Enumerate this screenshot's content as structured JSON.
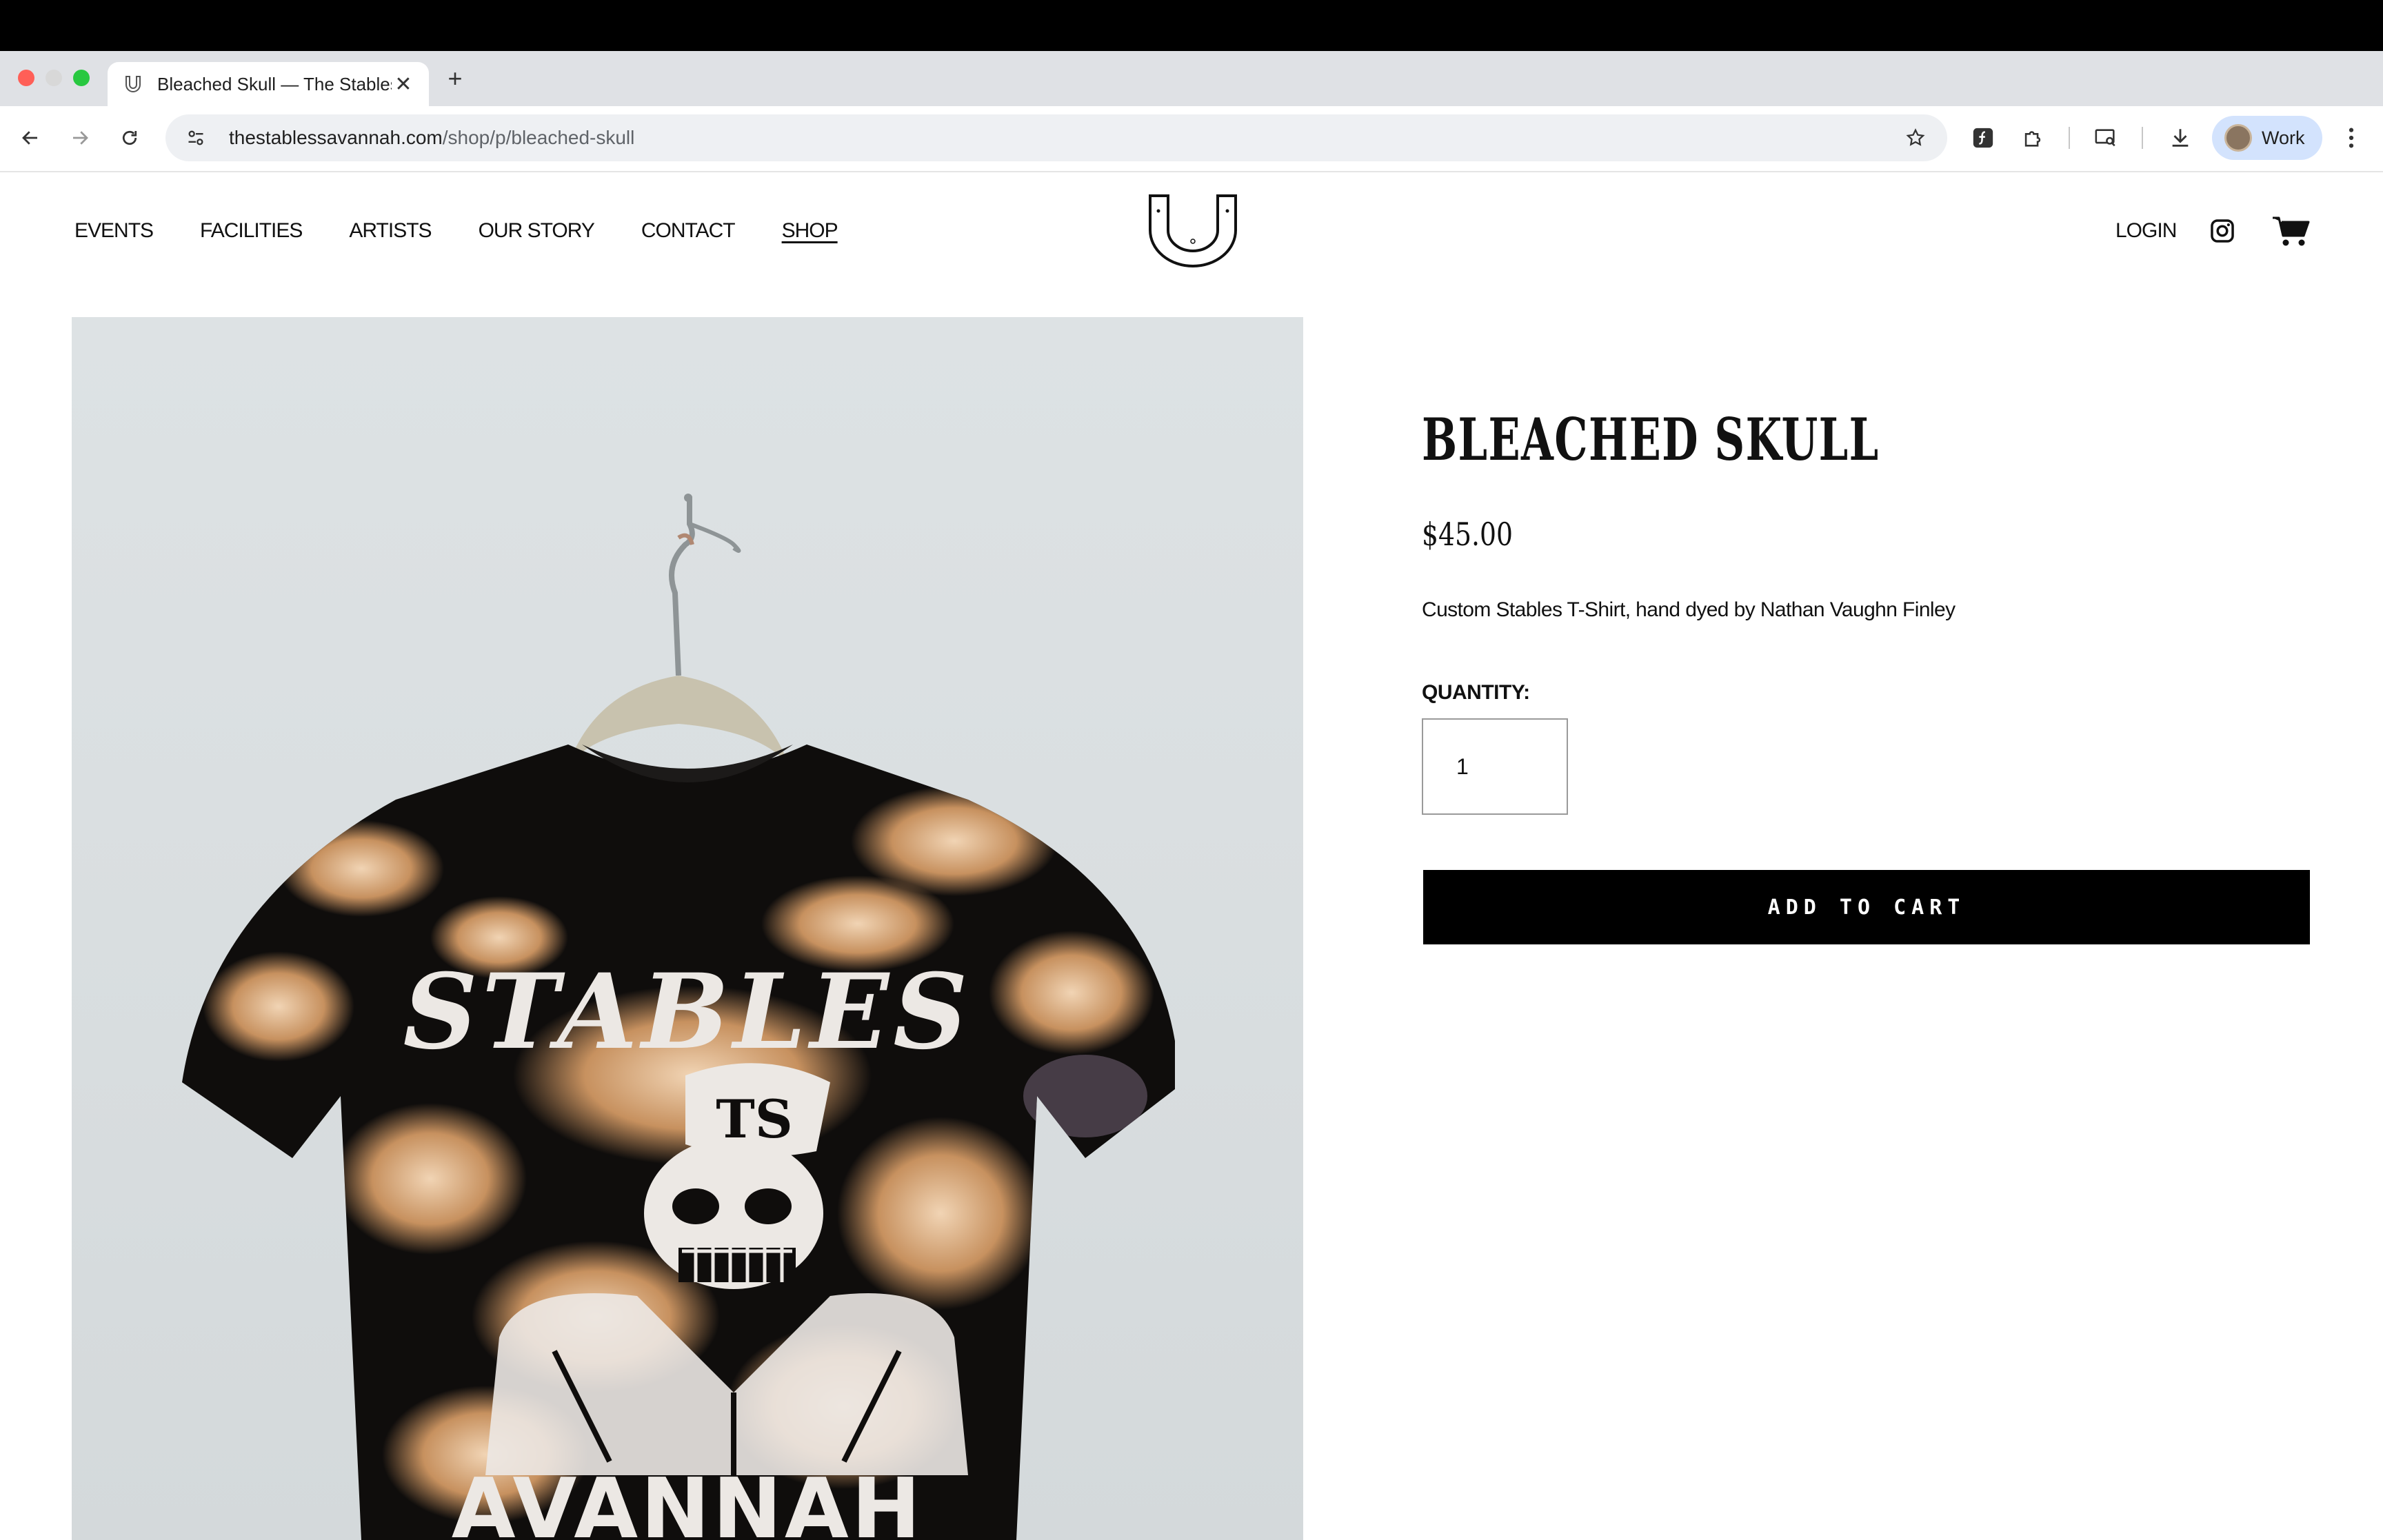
{
  "browser": {
    "tab": {
      "title": "Bleached Skull — The Stables",
      "close_icon": "close-icon"
    },
    "new_tab_label": "+",
    "url": {
      "domain": "thestablessavannah.com",
      "path": "/shop/p/bleached-skull"
    },
    "profile": {
      "label": "Work"
    },
    "icons": [
      "back-icon",
      "forward-icon",
      "reload-icon",
      "tune-icon",
      "star-icon",
      "extension-script-icon",
      "puzzle-icon",
      "cast-search-icon",
      "download-icon",
      "kebab-icon"
    ],
    "colors": {
      "chrome_bg": "#dfe1e5",
      "omnibox_bg": "#eef0f3",
      "profile_chip": "#d3e3fd"
    }
  },
  "site": {
    "nav": [
      {
        "label": "EVENTS"
      },
      {
        "label": "FACILITIES"
      },
      {
        "label": "ARTISTS"
      },
      {
        "label": "OUR STORY"
      },
      {
        "label": "CONTACT"
      },
      {
        "label": "SHOP",
        "active": true
      }
    ],
    "login_label": "LOGIN",
    "logo_icon": "stables-horseshoe-logo",
    "instagram_icon": "instagram-icon",
    "cart_icon": "cart-icon"
  },
  "product": {
    "title": "BLEACHED SKULL",
    "price": "$45.00",
    "description": "Custom Stables T-Shirt, hand dyed by Nathan Vaughn Finley",
    "quantity_label": "QUANTITY:",
    "quantity_value": "1",
    "add_to_cart_label": "ADD TO CART",
    "image": {
      "shirt_print_top": "STABLES",
      "shirt_print_cap": "TS",
      "shirt_print_bottom": "AVANNAH"
    }
  }
}
